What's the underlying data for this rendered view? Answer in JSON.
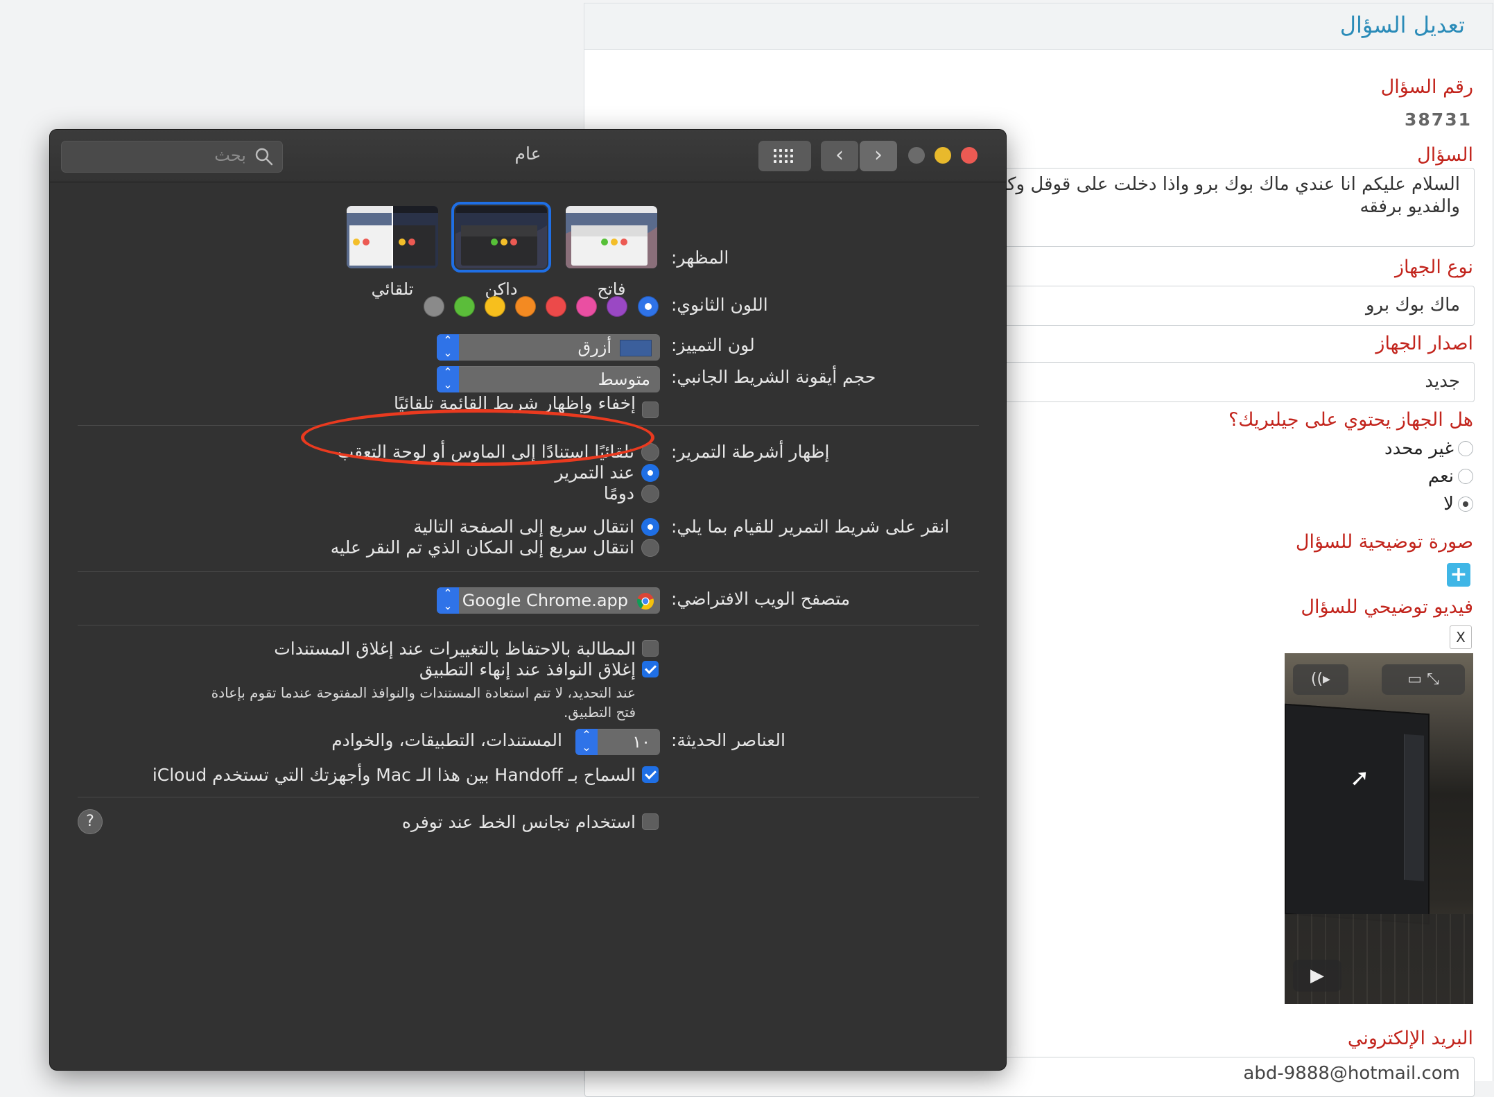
{
  "web": {
    "header_title": "تعديل السؤال",
    "question_number_label": "رقم السؤال",
    "question_number": "38731",
    "question_label": "السؤال",
    "question_text_line1": "السلام عليكم انا عندي ماك بوك برو واذا دخلت على قوقل وكبر",
    "question_text_line2": "والفديو برفقه",
    "device_type_label": "نوع الجهاز",
    "device_type_value": "ماك بوك برو",
    "device_version_label": "اصدار الجهاز",
    "device_version_value": "جديد",
    "jailbreak_label": "هل الجهاز يحتوي على جيلبريك؟",
    "jailbreak_options": [
      {
        "label": "غير محدد",
        "selected": false
      },
      {
        "label": "نعم",
        "selected": false
      },
      {
        "label": "لا",
        "selected": true
      }
    ],
    "image_label": "صورة توضيحية للسؤال",
    "add_symbol": "+",
    "video_label": "فيديو توضيحي للسؤال",
    "remove_symbol": "X",
    "email_label": "البريد الإلكتروني",
    "email_value": "abd-9888@hotmail.com"
  },
  "window": {
    "title": "عام",
    "search_placeholder": "بحث",
    "traffic_colors": {
      "close": "#ec5a53",
      "minimize": "#e8b92c",
      "zoom": "#6b6b6b"
    },
    "accent": "#1f6fe5"
  },
  "appearance": {
    "label": "المظهر:",
    "options": [
      {
        "name": "light",
        "caption": "فاتح",
        "selected": false
      },
      {
        "name": "dark",
        "caption": "داكن",
        "selected": true
      },
      {
        "name": "auto",
        "caption": "تلقائي",
        "selected": false
      }
    ]
  },
  "accent_color": {
    "label": "اللون الثانوي:",
    "colors": [
      "#2f73e8",
      "#9a48c4",
      "#ea4fa2",
      "#ec4a4a",
      "#f38a22",
      "#f7bf1d",
      "#5bbd3a",
      "#8a8a8a"
    ],
    "selected_index": 0
  },
  "highlight_color": {
    "label": "لون التمييز:",
    "value": "أزرق",
    "swatch": "#3b5f9c"
  },
  "sidebar_icon_size": {
    "label": "حجم أيقونة الشريط الجانبي:",
    "value": "متوسط"
  },
  "menubar_autohide": {
    "label": "إخفاء وإظهار شريط القائمة تلقائيًا",
    "checked": false
  },
  "show_scrollbars": {
    "label": "إظهار أشرطة التمرير:",
    "options": [
      {
        "label": "تلقائيًا استنادًا إلى الماوس أو لوحة التعقب",
        "selected": false
      },
      {
        "label": "عند التمرير",
        "selected": true
      },
      {
        "label": "دومًا",
        "selected": false
      }
    ]
  },
  "click_scrollbar": {
    "label": "انقر على شريط التمرير للقيام بما يلي:",
    "options": [
      {
        "label": "انتقال سريع إلى الصفحة التالية",
        "selected": true
      },
      {
        "label": "انتقال سريع إلى المكان الذي تم النقر عليه",
        "selected": false
      }
    ]
  },
  "default_browser": {
    "label": "متصفح الويب الافتراضي:",
    "value": "Google Chrome.app"
  },
  "ask_keep_changes": {
    "label": "المطالبة بالاحتفاظ بالتغييرات عند إغلاق المستندات",
    "checked": false
  },
  "close_windows": {
    "label": "إغلاق النوافذ عند إنهاء التطبيق",
    "checked": true
  },
  "close_windows_note_line1": "عند التحديد، لا تتم استعادة المستندات والنوافذ المفتوحة عندما تقوم بإعادة",
  "close_windows_note_line2": "فتح التطبيق.",
  "recent_items": {
    "label": "العناصر الحديثة:",
    "value": "١٠",
    "suffix": "المستندات، التطبيقات، والخوادم"
  },
  "handoff": {
    "label": "السماح بـ Handoff بين هذا الـ Mac وأجهزتك التي تستخدم iCloud",
    "checked": true
  },
  "font_smoothing": {
    "label": "استخدام تجانس الخط عند توفره",
    "checked": false
  },
  "help_symbol": "?"
}
